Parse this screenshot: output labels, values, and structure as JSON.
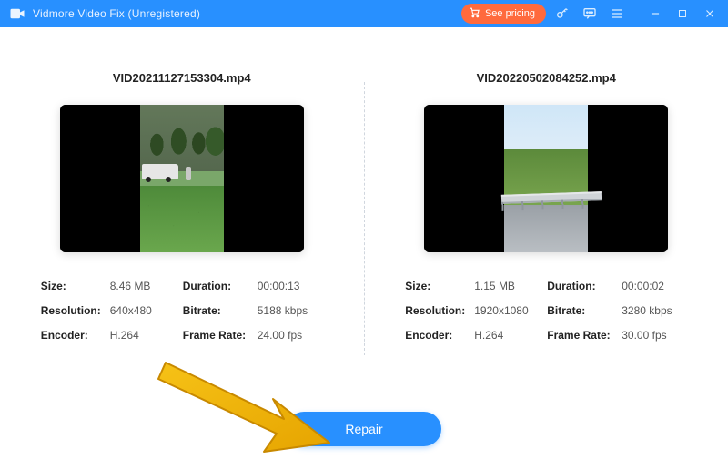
{
  "titlebar": {
    "app_name": "Vidmore Video Fix (Unregistered)",
    "see_pricing_label": "See pricing"
  },
  "left": {
    "filename": "VID20211127153304.mp4",
    "labels": {
      "size": "Size:",
      "duration": "Duration:",
      "resolution": "Resolution:",
      "bitrate": "Bitrate:",
      "encoder": "Encoder:",
      "frame_rate": "Frame Rate:"
    },
    "values": {
      "size": "8.46 MB",
      "duration": "00:00:13",
      "resolution": "640x480",
      "bitrate": "5188 kbps",
      "encoder": "H.264",
      "frame_rate": "24.00 fps"
    }
  },
  "right": {
    "filename": "VID20220502084252.mp4",
    "labels": {
      "size": "Size:",
      "duration": "Duration:",
      "resolution": "Resolution:",
      "bitrate": "Bitrate:",
      "encoder": "Encoder:",
      "frame_rate": "Frame Rate:"
    },
    "values": {
      "size": "1.15 MB",
      "duration": "00:00:02",
      "resolution": "1920x1080",
      "bitrate": "3280 kbps",
      "encoder": "H.264",
      "frame_rate": "30.00 fps"
    }
  },
  "action": {
    "repair_label": "Repair"
  }
}
